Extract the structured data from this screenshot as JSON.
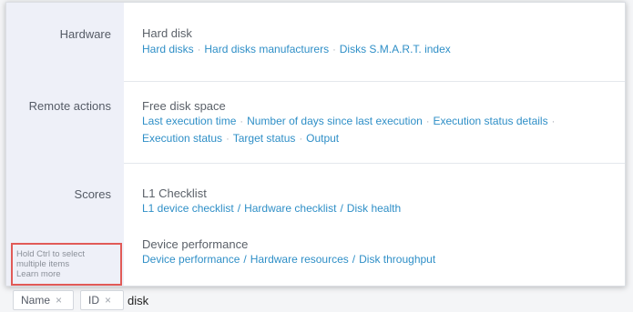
{
  "sections": [
    {
      "label": "Hardware",
      "groups": [
        {
          "title": "Hard disk",
          "links": [
            "Hard disks",
            "Hard disks manufacturers",
            "Disks S.M.A.R.T. index"
          ]
        }
      ]
    },
    {
      "label": "Remote actions",
      "groups": [
        {
          "title": "Free disk space",
          "links": [
            "Last execution time",
            "Number of days since last execution",
            "Execution status details",
            "Execution status",
            "Target status",
            "Output"
          ]
        }
      ]
    },
    {
      "label": "Scores",
      "groups": [
        {
          "title": "L1 Checklist",
          "links": [
            "L1 device checklist",
            "Hardware checklist",
            "Disk health"
          ]
        },
        {
          "title": "Device performance",
          "links": [
            "Device performance",
            "Hardware resources",
            "Disk throughput"
          ]
        }
      ]
    }
  ],
  "hint": {
    "line1": "Hold Ctrl to select",
    "line2": "multiple items",
    "learn_more": "Learn more"
  },
  "filter_bar": {
    "chips": [
      {
        "label": "Name",
        "remove": "×"
      },
      {
        "label": "ID",
        "remove": "×"
      }
    ],
    "input_value": "disk"
  },
  "colors": {
    "link": "#2f8fc7",
    "sidebar": "#eef0f8",
    "highlight_border": "#e15a57"
  }
}
